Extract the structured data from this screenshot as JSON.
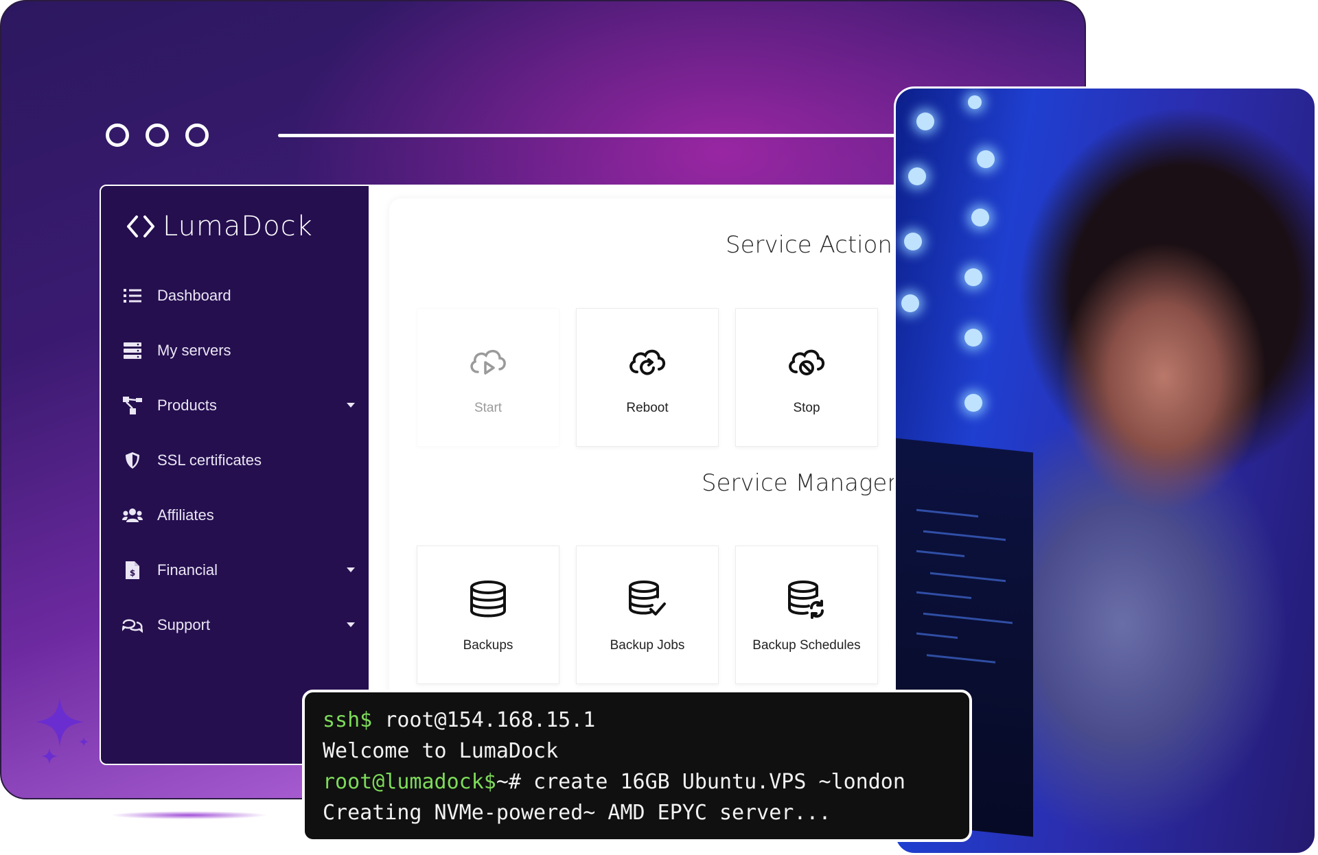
{
  "brand": {
    "name": "LumaDock"
  },
  "sidebar": {
    "items": [
      {
        "label": "Dashboard",
        "icon": "list-icon",
        "has_caret": false
      },
      {
        "label": "My servers",
        "icon": "servers-icon",
        "has_caret": false
      },
      {
        "label": "Products",
        "icon": "products-icon",
        "has_caret": true
      },
      {
        "label": "SSL certificates",
        "icon": "shield-icon",
        "has_caret": false
      },
      {
        "label": "Affiliates",
        "icon": "users-icon",
        "has_caret": false
      },
      {
        "label": "Financial",
        "icon": "invoice-icon",
        "has_caret": true
      },
      {
        "label": "Support",
        "icon": "chat-icon",
        "has_caret": true
      }
    ]
  },
  "main": {
    "service_actions": {
      "title": "Service Actions",
      "cards": [
        {
          "label": "Start",
          "icon": "cloud-play-icon",
          "disabled": true
        },
        {
          "label": "Reboot",
          "icon": "cloud-reboot-icon",
          "disabled": false
        },
        {
          "label": "Stop",
          "icon": "cloud-stop-icon",
          "disabled": false
        }
      ]
    },
    "service_management": {
      "title": "Service Manageme",
      "cards": [
        {
          "label": "Backups",
          "icon": "database-icon"
        },
        {
          "label": "Backup Jobs",
          "icon": "database-check-icon"
        },
        {
          "label": "Backup Schedules",
          "icon": "database-sync-icon"
        }
      ]
    }
  },
  "terminal": {
    "line1_prompt": "ssh$",
    "line1_cmd": " root@154.168.15.1",
    "line2": "Welcome to LumaDock",
    "line3_prompt": "root@lumadock$",
    "line3_cmd": "~# create 16GB Ubuntu.VPS ~london",
    "line4": "Creating NVMe-powered~ AMD EPYC server..."
  },
  "colors": {
    "sidebar_bg": "#250f4f",
    "terminal_prompt": "#7ddb5a",
    "terminal_bg": "#101010"
  }
}
